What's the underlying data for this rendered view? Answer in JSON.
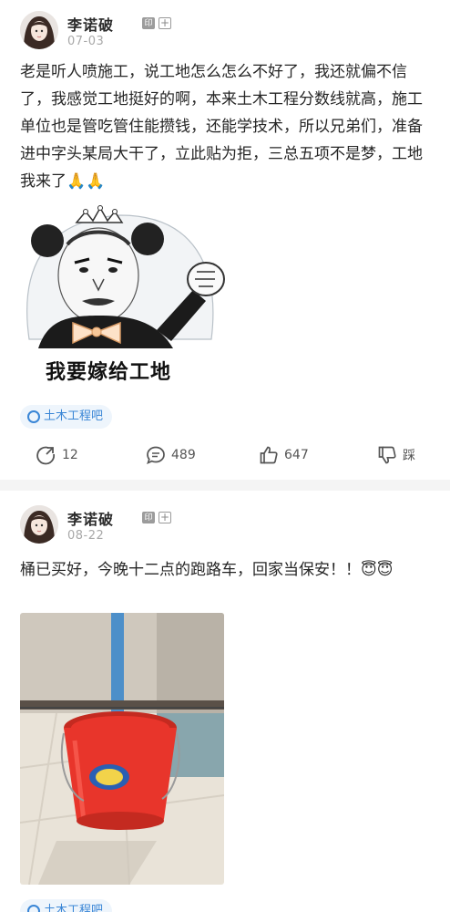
{
  "posts": [
    {
      "username": "李诺破",
      "badges": [
        "印",
        "+"
      ],
      "date": "07-03",
      "text": "老是听人喷施工，说工地怎么怎么不好了，我还就偏不信了，我感觉工地挺好的啊，本来土木工程分数线就高，施工单位也是管吃管住能攒钱，还能学技术，所以兄弟们，准备进中字头某局大干了，立此贴为拒，三总五项不是梦，工地我来了🙏🙏",
      "meme_caption": "我要嫁给工地",
      "tag": "土木工程吧",
      "actions": {
        "share": "12",
        "comment": "489",
        "like": "647",
        "dislike": "踩"
      }
    },
    {
      "username": "李诺破",
      "badges": [
        "印",
        "+"
      ],
      "date": "08-22",
      "text": "桶已买好，今晚十二点的跑路车，回家当保安！！😇😇",
      "tag": "土木工程吧"
    }
  ],
  "colors": {
    "accent": "#3a86d6",
    "bucket": "#e8352b",
    "divider": "#f4f4f4"
  },
  "icons": [
    "share-icon",
    "comment-icon",
    "like-icon",
    "dislike-icon",
    "bar-icon"
  ]
}
